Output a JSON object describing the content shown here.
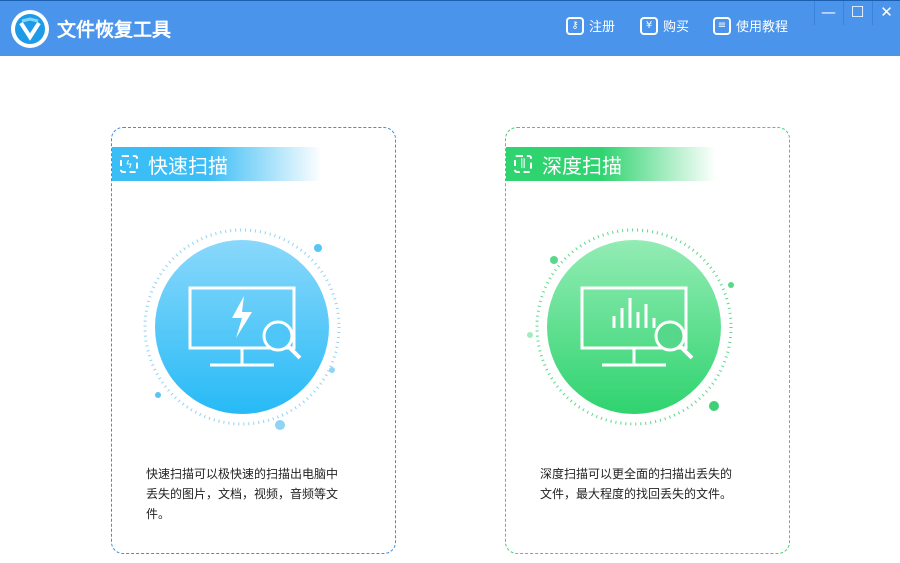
{
  "app": {
    "title": "文件恢复工具"
  },
  "nav": [
    {
      "label": "注册",
      "icon": "key-icon"
    },
    {
      "label": "购买",
      "icon": "yen-icon"
    },
    {
      "label": "使用教程",
      "icon": "document-icon"
    }
  ],
  "window": {
    "minimize": "—",
    "maximize": "☐",
    "close": "✕"
  },
  "cards": [
    {
      "title": "快速扫描",
      "desc": [
        "快速扫描可以极快速的扫描出电脑中",
        "丢失的图片，文档，视频，音频等文",
        "件。"
      ],
      "color": "#3bbdf5"
    },
    {
      "title": "深度扫描",
      "desc": [
        "深度扫描可以更全面的扫描出丢失的",
        "文件，最大程度的找回丢失的文件。"
      ],
      "color": "#2fd36f"
    }
  ]
}
